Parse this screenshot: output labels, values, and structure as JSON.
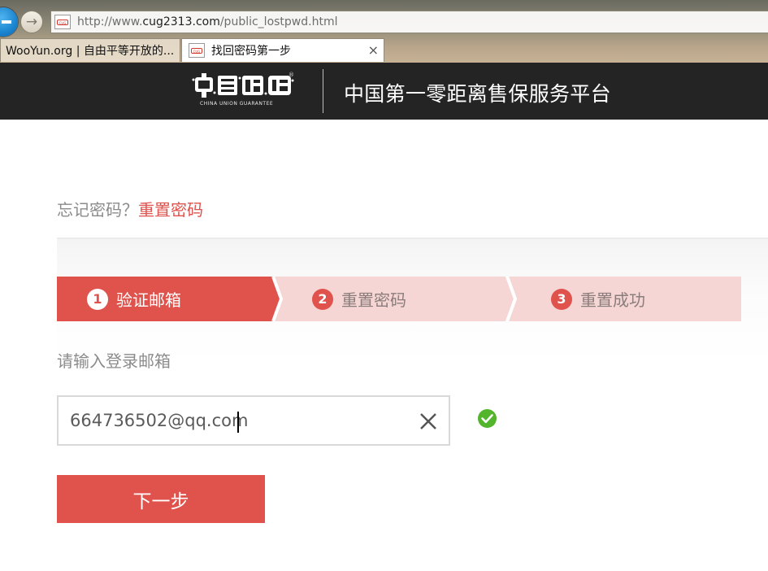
{
  "browser": {
    "url_prefix": "http://www.",
    "url_domain": "cug2313.com",
    "url_path": "/public_lostpwd.html",
    "tabs": [
      {
        "label": "WooYun.org | 自由平等开放的..."
      },
      {
        "label": "找回密码第一步",
        "close": "×"
      }
    ],
    "forward_glyph": "→",
    "favicon_text": "CUG"
  },
  "header": {
    "logo_subtext": "CHINA UNION GUARANTEE",
    "logo_reg": "®",
    "title": "中国第一零距离售保服务平台",
    "background": "#242424"
  },
  "breadcrumb": {
    "prefix": "忘记密码",
    "separator": "？",
    "current": "重置密码"
  },
  "steps": [
    {
      "number": "1",
      "label": "验证邮箱",
      "active": true
    },
    {
      "number": "2",
      "label": "重置密码",
      "active": false
    },
    {
      "number": "3",
      "label": "重置成功",
      "active": false
    }
  ],
  "form": {
    "email_label": "请输入登录邮箱",
    "email_value": "664736502@qq.com",
    "clear_icon": "close-icon",
    "valid_icon": "check-circle-icon",
    "next_label": "下一步"
  },
  "colors": {
    "accent": "#e0524c",
    "step_inactive_bg": "#f6d6d4",
    "valid": "#52b52b"
  }
}
